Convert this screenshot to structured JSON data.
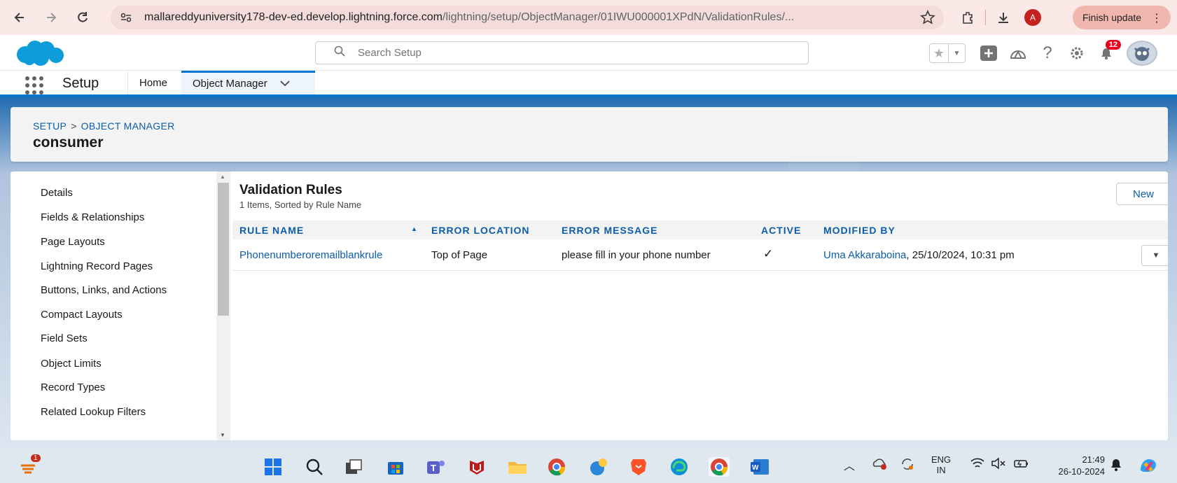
{
  "browser": {
    "url_host": "mallareddyuniversity178-dev-ed.develop.lightning.force.com",
    "url_path": "/lightning/setup/ObjectManager/01IWU000001XPdN/ValidationRules/...",
    "profile_initial": "A",
    "finish_update_label": "Finish update"
  },
  "header": {
    "search_placeholder": "Search Setup",
    "notification_count": "12"
  },
  "context_nav": {
    "app_name": "Setup",
    "tabs": [
      {
        "label": "Home"
      },
      {
        "label": "Object Manager"
      }
    ]
  },
  "page_header": {
    "breadcrumb_root": "SETUP",
    "breadcrumb_sep": ">",
    "breadcrumb_current": "OBJECT MANAGER",
    "title": "consumer"
  },
  "sidebar": {
    "items": [
      {
        "label": "Details"
      },
      {
        "label": "Fields & Relationships"
      },
      {
        "label": "Page Layouts"
      },
      {
        "label": "Lightning Record Pages"
      },
      {
        "label": "Buttons, Links, and Actions"
      },
      {
        "label": "Compact Layouts"
      },
      {
        "label": "Field Sets"
      },
      {
        "label": "Object Limits"
      },
      {
        "label": "Record Types"
      },
      {
        "label": "Related Lookup Filters"
      }
    ]
  },
  "main": {
    "title": "Validation Rules",
    "subtitle": "1 Items, Sorted by Rule Name",
    "new_button": "New",
    "columns": {
      "rule_name": "RULE NAME",
      "error_location": "ERROR LOCATION",
      "error_message": "ERROR MESSAGE",
      "active": "ACTIVE",
      "modified_by": "MODIFIED BY"
    },
    "rows": [
      {
        "rule_name": "Phonenumberoremailblankrule",
        "error_location": "Top of Page",
        "error_message": "please fill in your phone number",
        "active": "✓",
        "modified_by_name": "Uma Akkaraboina",
        "modified_by_date": ", 25/10/2024, 10:31 pm"
      }
    ]
  },
  "taskbar": {
    "widget_badge": "1",
    "lang_top": "ENG",
    "lang_bottom": "IN",
    "time": "21:49",
    "date": "26-10-2024"
  }
}
